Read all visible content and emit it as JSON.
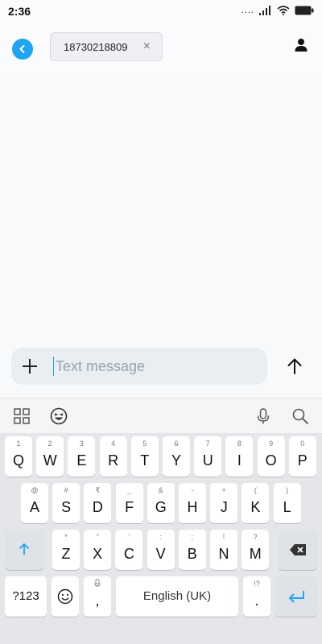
{
  "status": {
    "time": "2:36"
  },
  "header": {
    "recipient": "18730218809",
    "chip_close": "×"
  },
  "compose": {
    "placeholder": "Text message"
  },
  "keyboard": {
    "rows": [
      [
        {
          "hint": "1",
          "label": "Q"
        },
        {
          "hint": "2",
          "label": "W"
        },
        {
          "hint": "3",
          "label": "E"
        },
        {
          "hint": "4",
          "label": "R"
        },
        {
          "hint": "5",
          "label": "T"
        },
        {
          "hint": "6",
          "label": "Y"
        },
        {
          "hint": "7",
          "label": "U"
        },
        {
          "hint": "8",
          "label": "I"
        },
        {
          "hint": "9",
          "label": "O"
        },
        {
          "hint": "0",
          "label": "P"
        }
      ],
      [
        {
          "hint": "@",
          "label": "A"
        },
        {
          "hint": "#",
          "label": "S"
        },
        {
          "hint": "₹",
          "label": "D"
        },
        {
          "hint": "_",
          "label": "F"
        },
        {
          "hint": "&",
          "label": "G"
        },
        {
          "hint": "-",
          "label": "H"
        },
        {
          "hint": "+",
          "label": "J"
        },
        {
          "hint": "(",
          "label": "K"
        },
        {
          "hint": ")",
          "label": "L"
        }
      ],
      [
        {
          "hint": "*",
          "label": "Z"
        },
        {
          "hint": "\"",
          "label": "X"
        },
        {
          "hint": "'",
          "label": "C"
        },
        {
          "hint": ":",
          "label": "V"
        },
        {
          "hint": ";",
          "label": "B"
        },
        {
          "hint": "!",
          "label": "N"
        },
        {
          "hint": "?",
          "label": "M"
        }
      ]
    ],
    "symbols_label": "?123",
    "comma_label": ",",
    "space_label": "English (UK)",
    "period_label": ".",
    "period_hint": "!?"
  },
  "colors": {
    "accent": "#1ea4f0",
    "background": "#f7f9fb",
    "keyboard_bg": "#e4e6e9"
  },
  "icons": {
    "back": "chevron-left-icon",
    "contact": "person-icon",
    "attach": "plus-icon",
    "send": "arrow-up-icon",
    "apps": "grid-icon",
    "emoji": "emoji-icon",
    "mic": "mic-icon",
    "search": "search-icon",
    "shift": "shift-icon",
    "backspace": "backspace-icon",
    "enter": "enter-icon",
    "signal": "signal-icon",
    "wifi": "wifi-icon",
    "battery": "battery-icon"
  }
}
